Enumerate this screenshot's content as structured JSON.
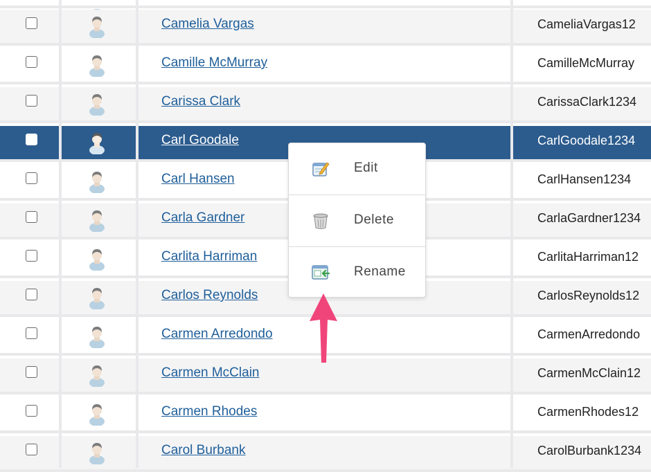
{
  "users": [
    {
      "name": "",
      "username": "",
      "selected": false
    },
    {
      "name": "Camelia Vargas",
      "username": "CameliaVargas12",
      "selected": false
    },
    {
      "name": "Camille McMurray",
      "username": "CamilleMcMurray",
      "selected": false
    },
    {
      "name": "Carissa Clark",
      "username": "CarissaClark1234",
      "selected": false
    },
    {
      "name": "Carl Goodale",
      "username": "CarlGoodale1234",
      "selected": true
    },
    {
      "name": "Carl Hansen",
      "username": "CarlHansen1234",
      "selected": false
    },
    {
      "name": "Carla Gardner",
      "username": "CarlaGardner1234",
      "selected": false
    },
    {
      "name": "Carlita Harriman",
      "username": "CarlitaHarriman12",
      "selected": false
    },
    {
      "name": "Carlos Reynolds",
      "username": "CarlosReynolds12",
      "selected": false
    },
    {
      "name": "Carmen Arredondo",
      "username": "CarmenArredondo",
      "selected": false
    },
    {
      "name": "Carmen McClain",
      "username": "CarmenMcClain12",
      "selected": false
    },
    {
      "name": "Carmen Rhodes",
      "username": "CarmenRhodes12",
      "selected": false
    },
    {
      "name": "Carol Burbank",
      "username": "CarolBurbank1234",
      "selected": false
    }
  ],
  "context_menu": {
    "items": [
      {
        "label": "Edit",
        "icon": "edit-icon"
      },
      {
        "label": "Delete",
        "icon": "trash-icon"
      },
      {
        "label": "Rename",
        "icon": "rename-icon"
      }
    ]
  },
  "colors": {
    "selected_row": "#2c5c8e",
    "link": "#1f5f9a",
    "annotation_arrow": "#f0457a"
  }
}
